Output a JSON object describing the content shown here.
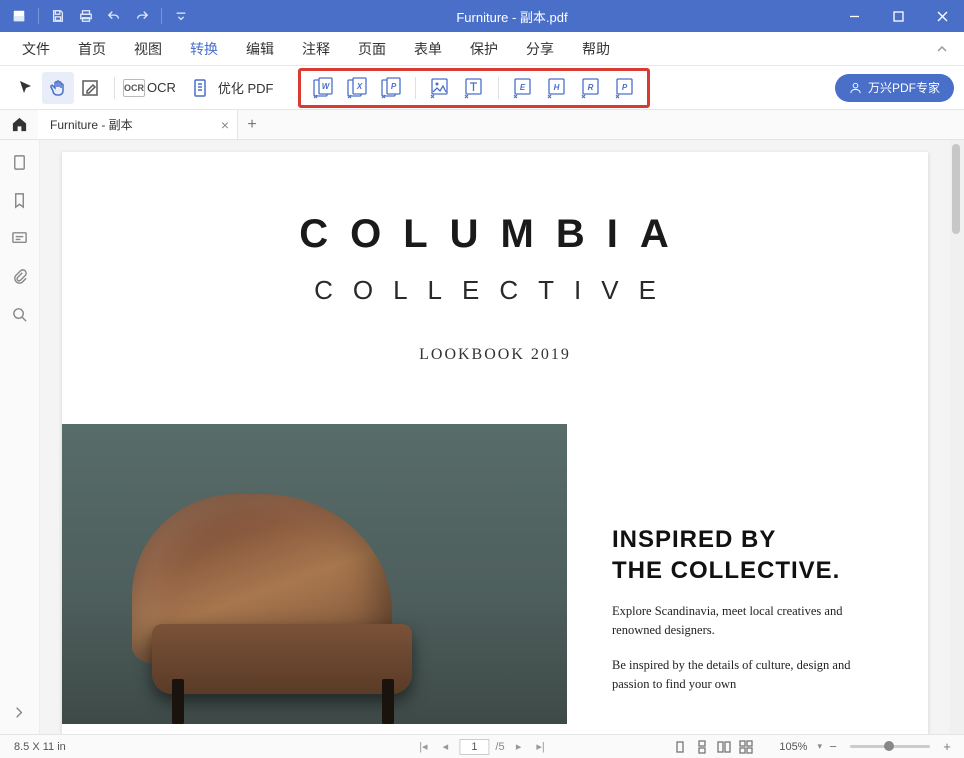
{
  "titlebar": {
    "title": "Furniture - 副本.pdf"
  },
  "menu": {
    "items": [
      "文件",
      "首页",
      "视图",
      "转换",
      "编辑",
      "注释",
      "页面",
      "表单",
      "保护",
      "分享",
      "帮助"
    ],
    "active_index": 3
  },
  "toolbar": {
    "ocr_label": "OCR",
    "ocr_box": "OCR",
    "optimize_label": "优化 PDF"
  },
  "convert": {
    "letters": [
      "W",
      "X",
      "P",
      "",
      "",
      "E",
      "H",
      "R",
      "P"
    ]
  },
  "promo": {
    "label": "万兴PDF专家"
  },
  "tab": {
    "title": "Furniture - 副本"
  },
  "doc": {
    "brand": "COLUMBIA",
    "sub": "COLLECTIVE",
    "look": "LOOKBOOK 2019",
    "h2a": "INSPIRED BY",
    "h2b": "THE COLLECTIVE.",
    "p1": "Explore Scandinavia, meet local creatives and renowned designers.",
    "p2": "Be inspired by the details of culture, design and passion to find your own"
  },
  "status": {
    "dim": "8.5 X 11 in",
    "page_current": "1",
    "page_total": "/5",
    "zoom": "105%"
  }
}
